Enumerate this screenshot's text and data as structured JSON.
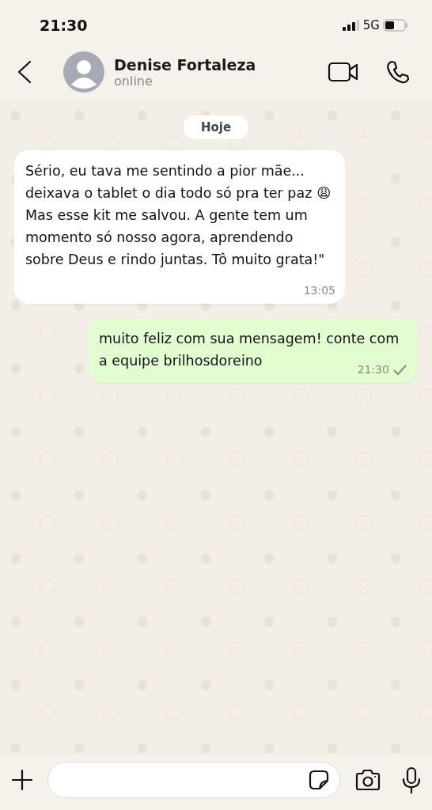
{
  "status_bar": {
    "time": "21:30",
    "network": "5G"
  },
  "header": {
    "name": "Denise Fortaleza",
    "presence": "online"
  },
  "date_chip": "Hoje",
  "messages": [
    {
      "kind": "incoming",
      "text": "Sério, eu tava me sentindo a pior mãe... deixava o tablet o dia todo só pra ter paz 😩 Mas esse kit me salvou. A gente tem um momento só nosso agora, aprendendo sobre Deus e rindo juntas. Tô muito grata!\"",
      "time": "13:05"
    },
    {
      "kind": "outgoing",
      "text": "muito feliz com sua mensagem! conte com a equipe brilhosdoreino",
      "time": "21:30",
      "read": false
    }
  ]
}
